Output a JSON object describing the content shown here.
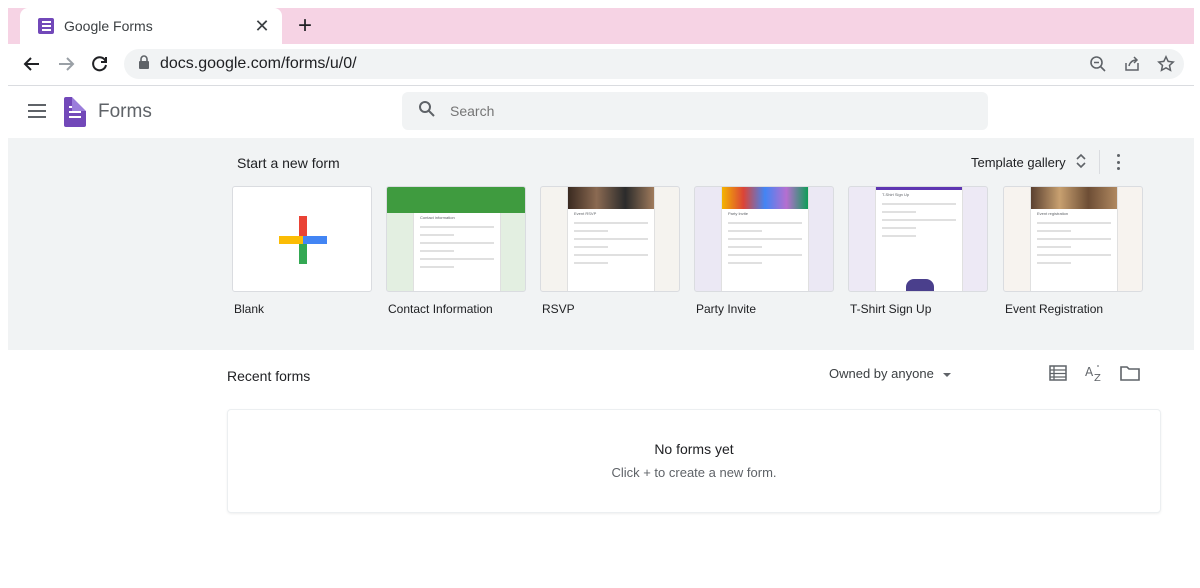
{
  "browser": {
    "tab_title": "Google Forms",
    "tab_close": "✕",
    "new_tab": "+",
    "url": "docs.google.com/forms/u/0/"
  },
  "app": {
    "name": "Forms",
    "search_placeholder": "Search",
    "brand_color": "#7248b9"
  },
  "templates": {
    "section_title": "Start a new form",
    "gallery_label": "Template gallery",
    "items": [
      {
        "label": "Blank",
        "icon": "plus-icon"
      },
      {
        "label": "Contact Information",
        "doc_title": "Contact information",
        "header_color": "#3f9b3f"
      },
      {
        "label": "RSVP",
        "doc_title": "Event RSVP",
        "header_color": "#5b3a29"
      },
      {
        "label": "Party Invite",
        "doc_title": "Party Invite",
        "header_color": "#b66fd0"
      },
      {
        "label": "T-Shirt Sign Up",
        "doc_title": "T-Shirt Sign Up",
        "header_color": "#5e35b1"
      },
      {
        "label": "Event Registration",
        "doc_title": "Event registration",
        "header_color": "#8a6a45"
      }
    ]
  },
  "recent": {
    "title": "Recent forms",
    "owner_filter": "Owned by anyone",
    "empty_title": "No forms yet",
    "empty_subtitle": "Click + to create a new form."
  }
}
